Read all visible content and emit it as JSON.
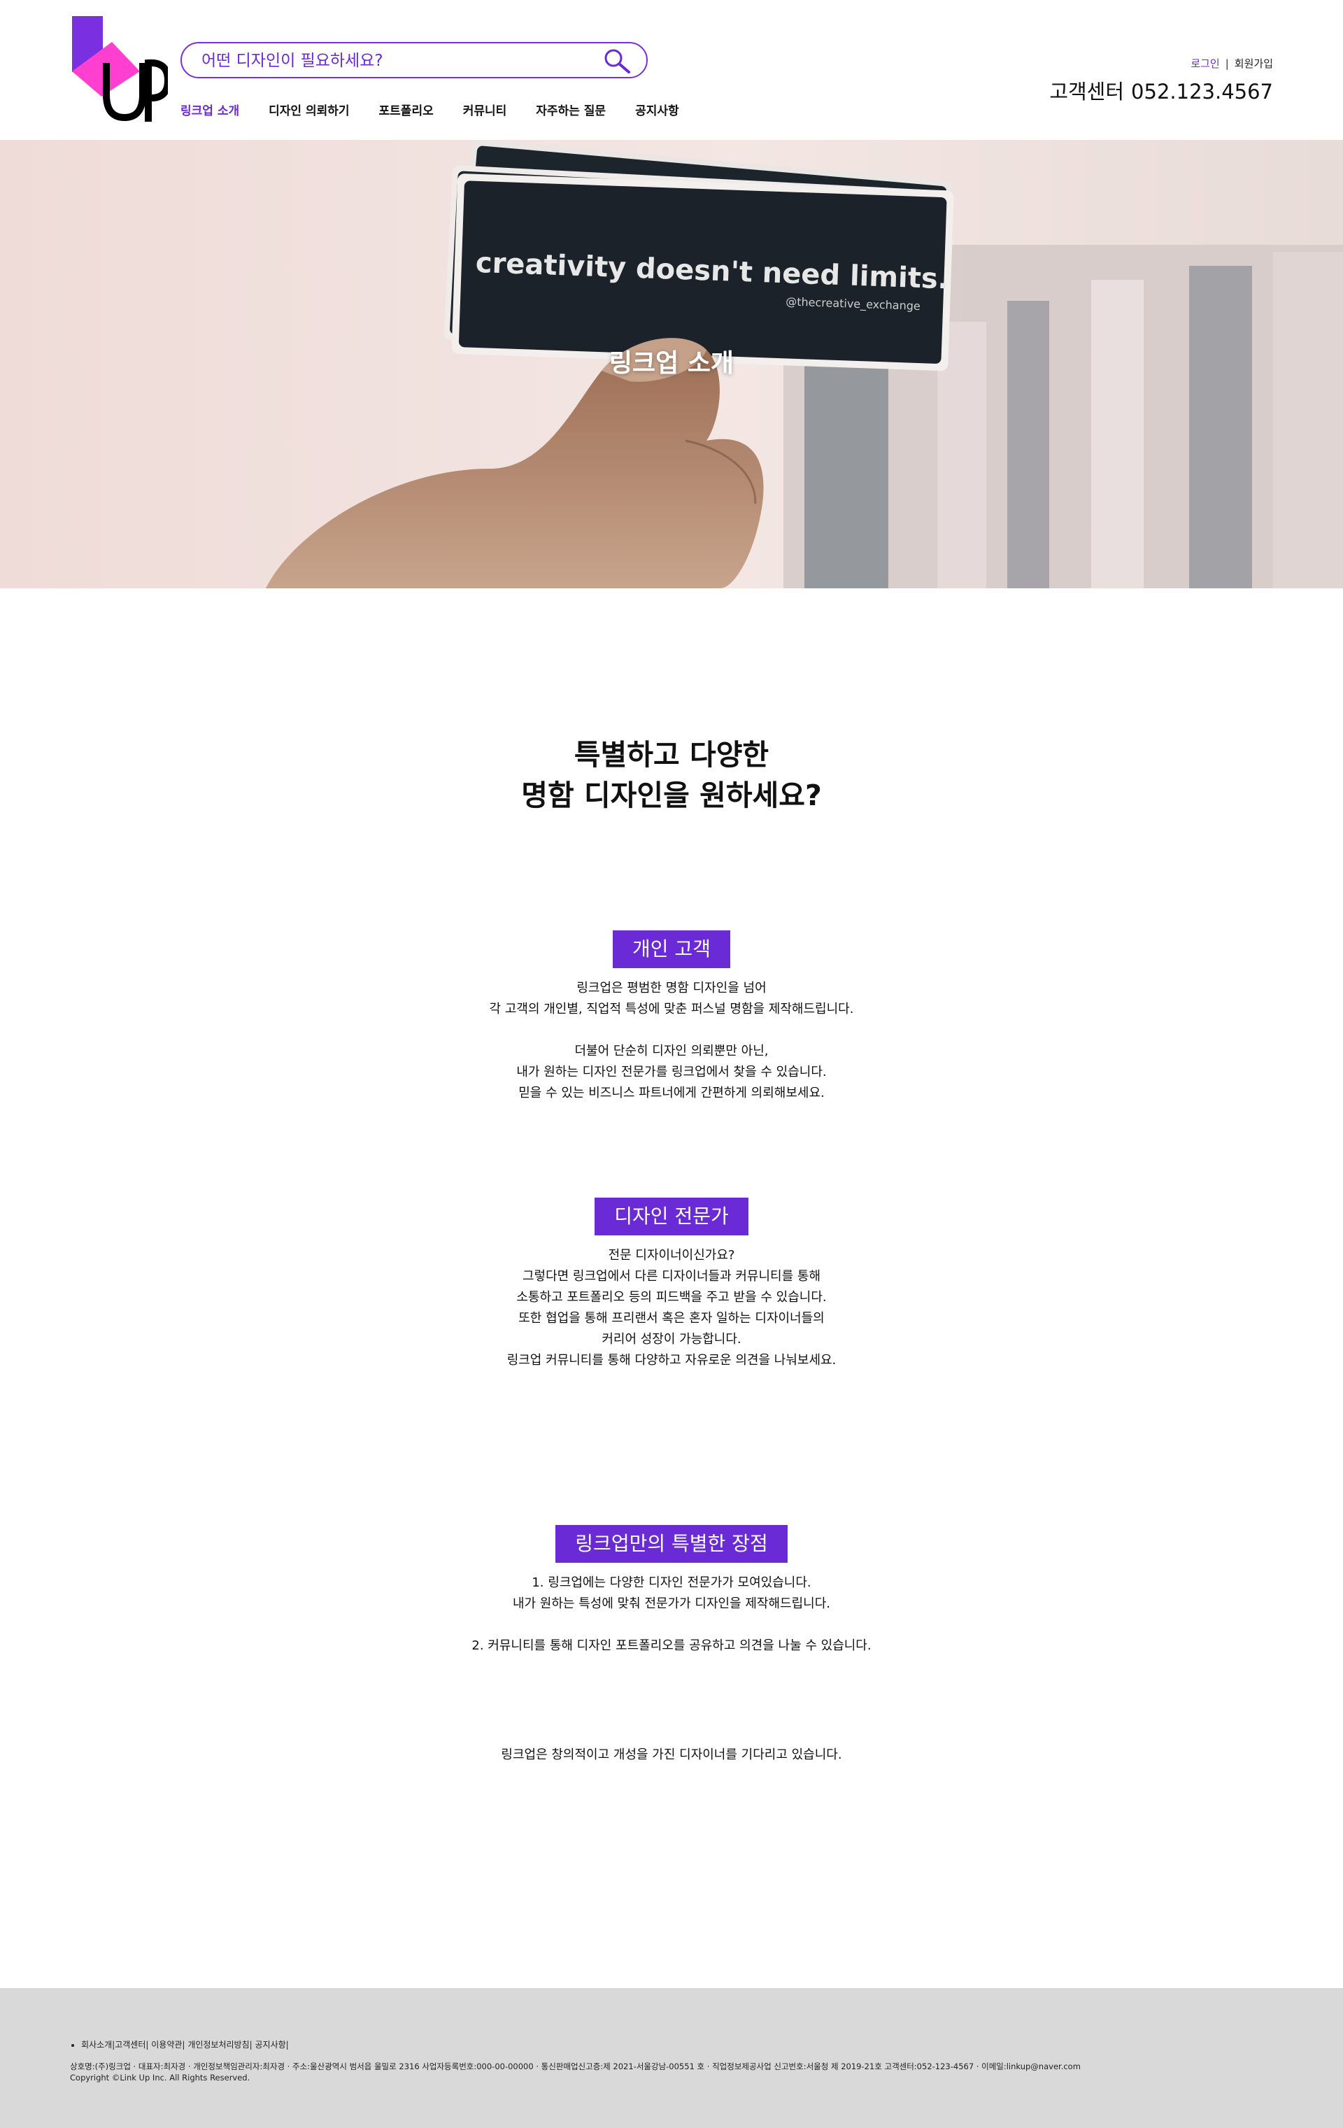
{
  "header": {
    "logo_alt": "Link Up",
    "search": {
      "placeholder": "어떤 디자인이 필요하세요?"
    },
    "nav": [
      {
        "label": "링크업 소개"
      },
      {
        "label": "디자인 의뢰하기"
      },
      {
        "label": "포트폴리오"
      },
      {
        "label": "커뮤니티"
      },
      {
        "label": "자주하는 질문"
      },
      {
        "label": "공지사항"
      }
    ],
    "login_label": "로그인",
    "divider": "|",
    "signup_label": "회원가입",
    "cs_label": "고객센터",
    "cs_phone": "052.123.4567"
  },
  "hero": {
    "title": "링크업 소개",
    "card_text": "creativity doesn't need limits.",
    "card_handle": "@thecreative_exchange"
  },
  "intro": {
    "headline_line1": "특별하고 다양한",
    "headline_line2": "명함 디자인을 원하세요?"
  },
  "sections": [
    {
      "badge": "개인 고객",
      "paragraphs": [
        [
          "링크업은 평범한 명함 디자인을 넘어",
          "각 고객의 개인별, 직업적 특성에 맞춘 퍼스널 명함을 제작해드립니다."
        ],
        [
          "더불어 단순히 디자인 의뢰뿐만 아닌,",
          "내가 원하는 디자인 전문가를 링크업에서 찾을 수 있습니다.",
          "믿을 수 있는 비즈니스 파트너에게 간편하게 의뢰해보세요."
        ]
      ]
    },
    {
      "badge": "디자인 전문가",
      "paragraphs": [
        [
          "전문 디자이너이신가요?",
          "그렇다면 링크업에서 다른 디자이너들과 커뮤니티를 통해",
          "소통하고 포트폴리오 등의 피드백을 주고 받을 수 있습니다.",
          "또한 협업을 통해 프리랜서 혹은 혼자 일하는 디자이너들의",
          "커리어 성장이 가능합니다.",
          "링크업 커뮤니티를 통해 다양하고 자유로운 의견을 나눠보세요."
        ]
      ]
    },
    {
      "badge": "링크업만의 특별한 장점",
      "paragraphs": [
        [
          "1. 링크업에는 다양한 디자인 전문가가 모여있습니다.",
          "내가 원하는 특성에 맞춰 전문가가 디자인을 제작해드립니다."
        ],
        [
          "2. 커뮤니티를 통해 디자인 포트폴리오를 공유하고 의견을 나눌 수 있습니다."
        ]
      ]
    }
  ],
  "closing": "링크업은 창의적이고 개성을 가진 디자이너를 기다리고 있습니다.",
  "footer": {
    "links": [
      "회사소개|",
      "고객센터|",
      "이용약관|",
      "개인정보처리방침|",
      "공지사항|"
    ],
    "company_info": "상호명:(주)링크업 · 대표자:최자경 · 개인정보책임관리자:최자경 · 주소:울산광역시 범서읍 울밀로 2316 사업자등록번호:000-00-00000 · 통신판매업신고증:제 2021-서울강남-00551 호 · 직업정보제공사업 신고번호:서울청 제 2019-21호 고객센터:052-123-4567 · 이메일:linkup@naver.com",
    "copyright": "Copyright ©Link Up Inc. All Rights Reserved."
  },
  "colors": {
    "accent": "#6a2bd6",
    "logo_pink": "#ff3fd0",
    "logo_purple": "#7a2fe0",
    "footer_bg": "#d9d9d9"
  }
}
